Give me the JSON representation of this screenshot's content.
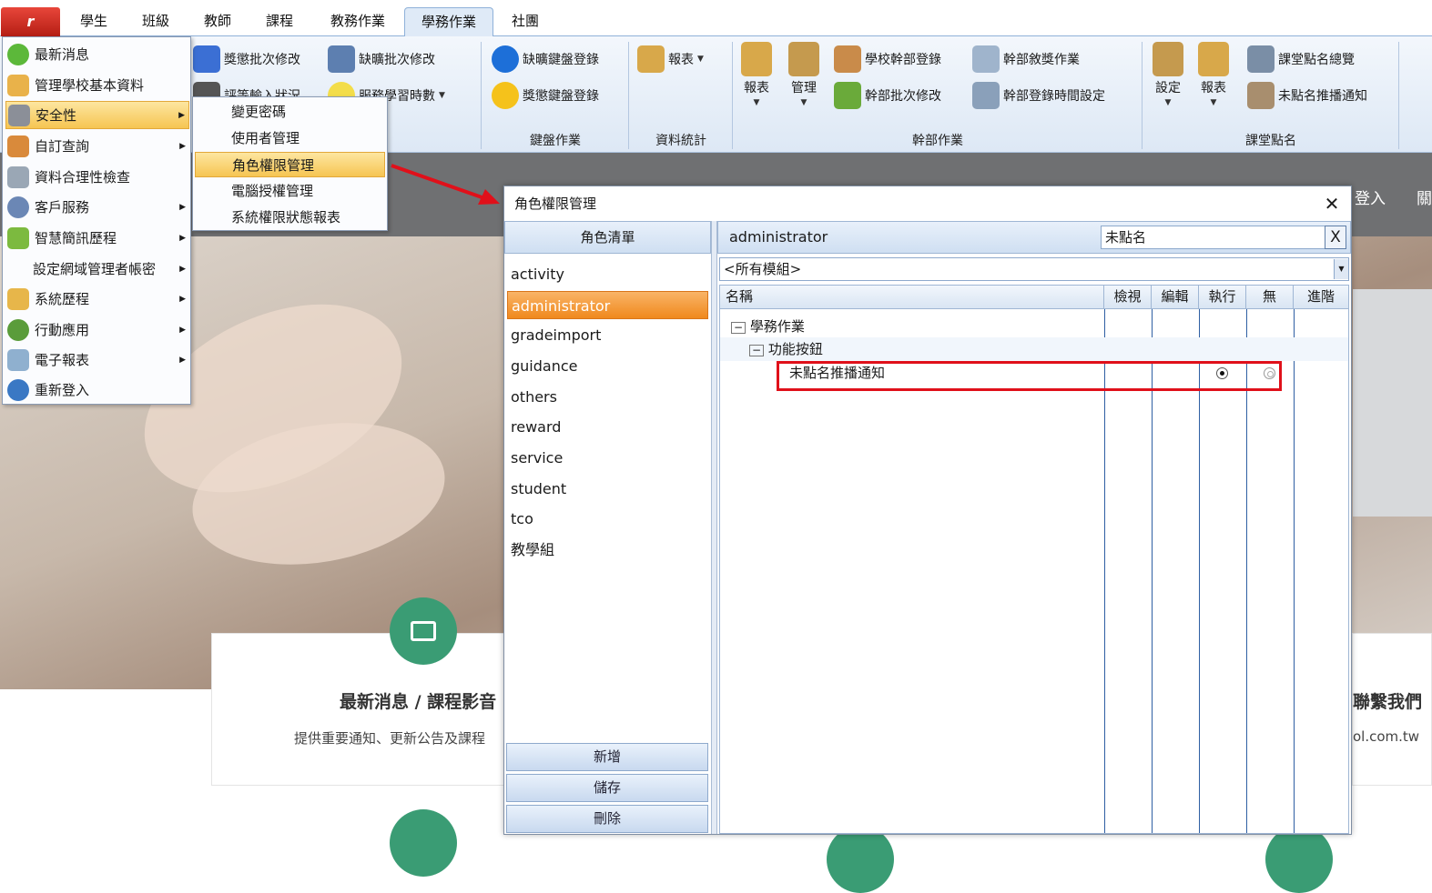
{
  "tabs": {
    "app_button": "r",
    "items": [
      "學生",
      "班級",
      "教師",
      "課程",
      "教務作業",
      "學務作業",
      "社團"
    ],
    "active": "學務作業"
  },
  "ribbon": {
    "g1": {
      "a": "獎懲批次修改",
      "b": "缺曠批次修改",
      "c": "評等輸入狀況",
      "d": "服務學習時數"
    },
    "g2": {
      "a": "缺曠鍵盤登錄",
      "b": "獎懲鍵盤登錄",
      "label": "鍵盤作業"
    },
    "g3": {
      "a": "報表",
      "label": "資料統計"
    },
    "g4": {
      "report": "報表",
      "manage": "管理",
      "a": "學校幹部登錄",
      "b": "幹部敘獎作業",
      "c": "幹部批次修改",
      "d": "幹部登錄時間設定",
      "label": "幹部作業"
    },
    "g5": {
      "settings": "設定",
      "report": "報表",
      "a": "課堂點名總覽",
      "b": "未點名推播通知",
      "label": "課堂點名"
    }
  },
  "start_menu": {
    "items": [
      {
        "label": "最新消息",
        "icon": "news-icon",
        "has_sub": false
      },
      {
        "label": "管理學校基本資料",
        "icon": "school-icon",
        "has_sub": false
      },
      {
        "label": "安全性",
        "icon": "tools-icon",
        "has_sub": true
      },
      {
        "label": "自訂查詢",
        "icon": "database-icon",
        "has_sub": true
      },
      {
        "label": "資料合理性檢查",
        "icon": "check-icon",
        "has_sub": false
      },
      {
        "label": "客戶服務",
        "icon": "user-icon",
        "has_sub": true
      },
      {
        "label": "智慧簡訊歷程",
        "icon": "sms-icon",
        "has_sub": true
      },
      {
        "label": "設定網域管理者帳密",
        "icon": "none",
        "has_sub": true
      },
      {
        "label": "系統歷程",
        "icon": "folder-icon",
        "has_sub": true
      },
      {
        "label": "行動應用",
        "icon": "tree-icon",
        "has_sub": true
      },
      {
        "label": "電子報表",
        "icon": "mail-icon",
        "has_sub": true
      },
      {
        "label": "重新登入",
        "icon": "globe-icon",
        "has_sub": false
      }
    ],
    "selected": "安全性"
  },
  "submenu": {
    "items": [
      "變更密碼",
      "使用者管理",
      "角色權限管理",
      "電腦授權管理",
      "系統權限狀態報表"
    ],
    "selected": "角色權限管理"
  },
  "site": {
    "login": "登入",
    "cut": "關",
    "card1_title": "最新消息 / 課程影音",
    "card1_text": "提供重要通知、更新公告及課程",
    "card3_title": "聯繫我們",
    "card3_text": "ol.com.tw"
  },
  "dialog": {
    "title": "角色權限管理",
    "role_header": "角色清單",
    "roles": [
      "activity",
      "administrator",
      "gradeimport",
      "guidance",
      "others",
      "reward",
      "service",
      "student",
      "tco",
      "教學組"
    ],
    "selected_role": "administrator",
    "buttons": {
      "add": "新增",
      "save": "儲存",
      "delete": "刪除"
    },
    "current_role": "administrator",
    "search_value": "未點名",
    "search_clear": "X",
    "module_filter": "<所有模組>",
    "columns": [
      "名稱",
      "檢視",
      "編輯",
      "執行",
      "無",
      "進階"
    ],
    "tree": {
      "root": "學務作業",
      "child": "功能按鈕",
      "leaf": "未點名推播通知"
    },
    "leaf_permission": "執行"
  }
}
